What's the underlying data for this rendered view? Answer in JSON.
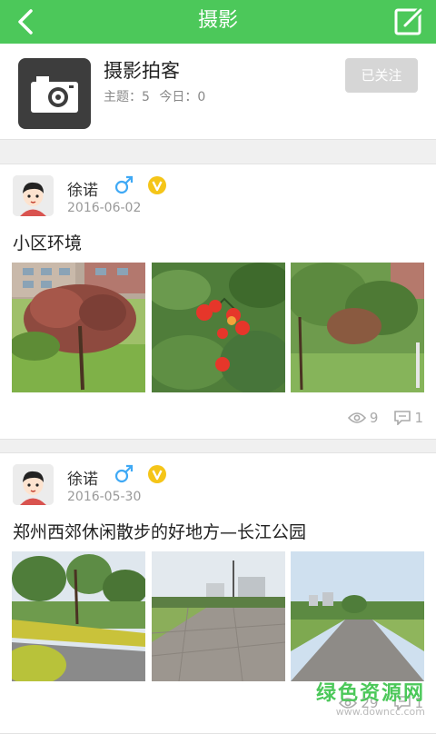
{
  "header": {
    "title": "摄影"
  },
  "forum": {
    "name": "摄影拍客",
    "topics_label": "主题：",
    "topics_value": "5",
    "today_label": "今日：",
    "today_value": "0",
    "follow_label": "已关注"
  },
  "posts": [
    {
      "author": "徐诺",
      "date": "2016-06-02",
      "title": "小区环境",
      "views": "9",
      "comments": "1"
    },
    {
      "author": "徐诺",
      "date": "2016-05-30",
      "title": "郑州西郊休闲散步的好地方—长江公园",
      "views": "29",
      "comments": "1"
    }
  ],
  "watermark": {
    "line1": "绿色资源网",
    "line2": "www.downcc.com"
  },
  "colors": {
    "accent": "#4cc85a",
    "follow_bg": "#d6d6d6"
  }
}
